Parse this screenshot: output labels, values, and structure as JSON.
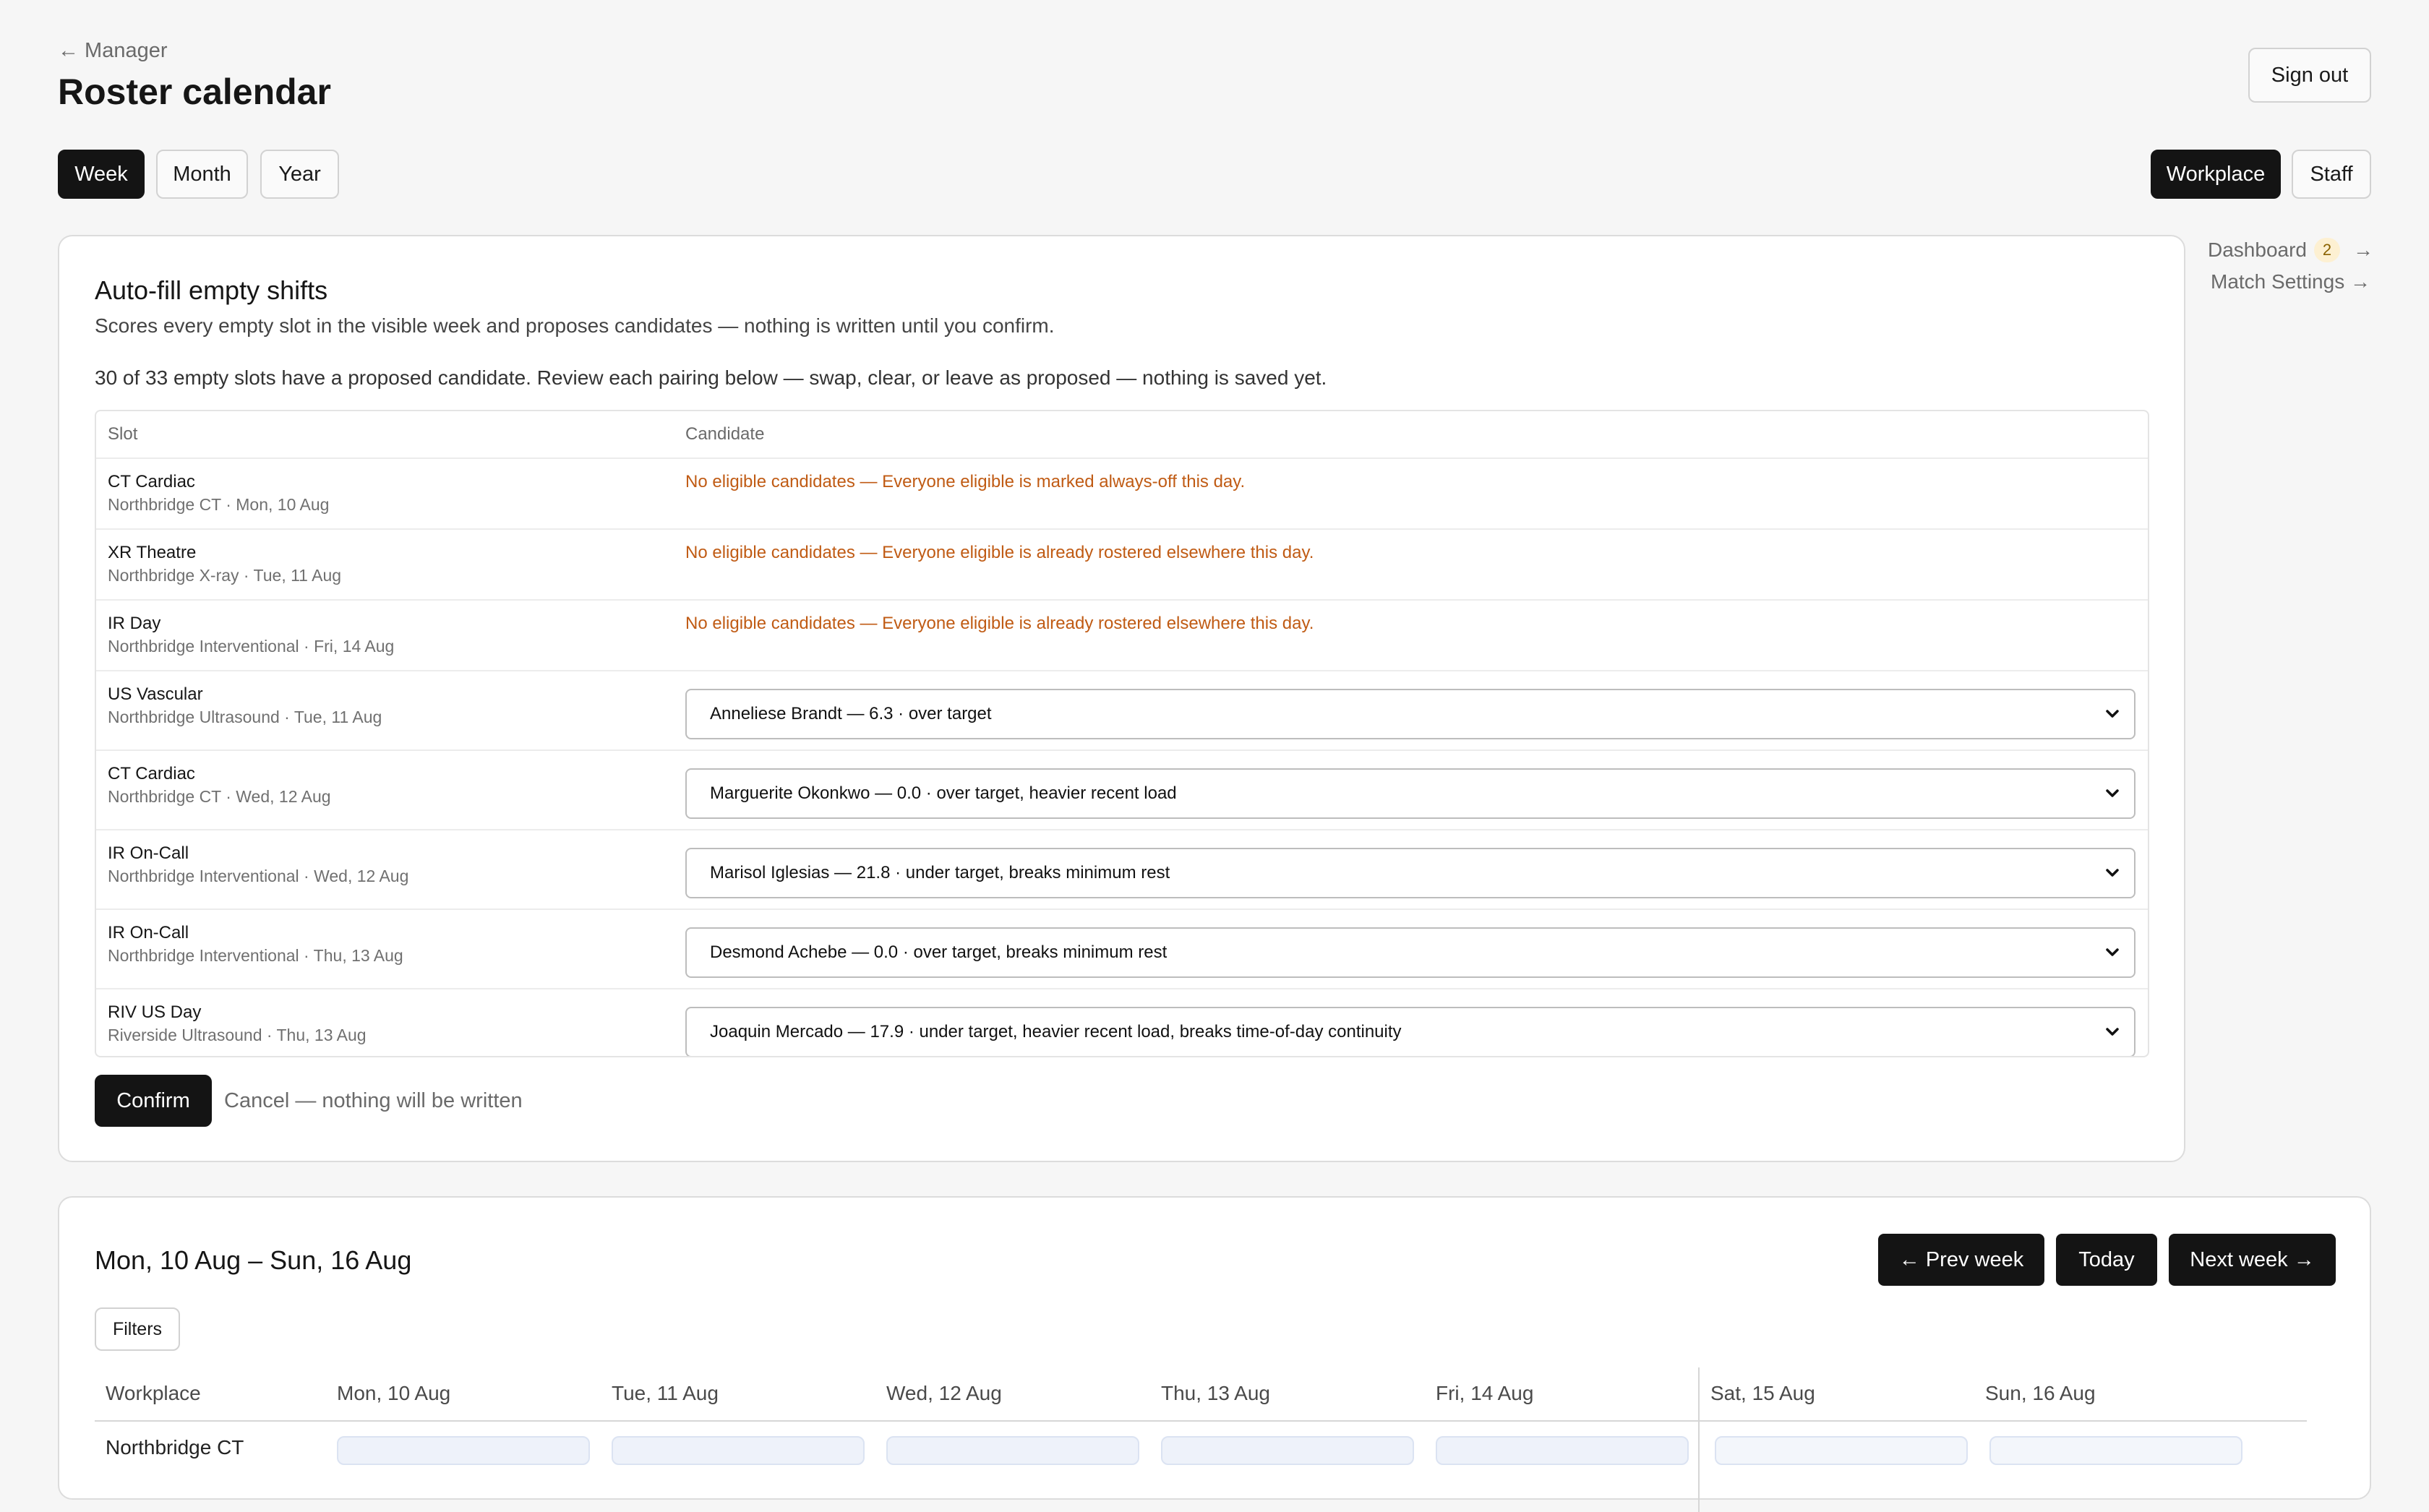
{
  "header": {
    "back_label": "← Manager",
    "title": "Roster calendar",
    "sign_out": "Sign out"
  },
  "view_tabs": [
    "Week",
    "Month",
    "Year"
  ],
  "active_view": "Week",
  "scope_tabs": [
    "Workplace",
    "Staff"
  ],
  "active_scope": "Workplace",
  "side_links": {
    "dashboard": "Dashboard",
    "dashboard_badge": "2",
    "dashboard_arrow": "→",
    "match_settings": "Match Settings →"
  },
  "autofill": {
    "title": "Auto-fill empty shifts",
    "description": "Scores every empty slot in the visible week and proposes candidates — nothing is written until you confirm.",
    "summary": "30 of 33 empty slots have a proposed candidate. Review each pairing below — swap, clear, or leave as proposed — nothing is saved yet.",
    "columns": {
      "slot": "Slot",
      "candidate": "Candidate"
    },
    "rows": [
      {
        "slot": "CT Cardiac",
        "location": "Northbridge CT · Mon, 10 Aug",
        "warning": "No eligible candidates — Everyone eligible is marked always-off this day."
      },
      {
        "slot": "XR Theatre",
        "location": "Northbridge X-ray · Tue, 11 Aug",
        "warning": "No eligible candidates — Everyone eligible is already rostered elsewhere this day."
      },
      {
        "slot": "IR Day",
        "location": "Northbridge Interventional · Fri, 14 Aug",
        "warning": "No eligible candidates — Everyone eligible is already rostered elsewhere this day."
      },
      {
        "slot": "US Vascular",
        "location": "Northbridge Ultrasound · Tue, 11 Aug",
        "candidate": "Anneliese Brandt — 6.3 · over target"
      },
      {
        "slot": "CT Cardiac",
        "location": "Northbridge CT · Wed, 12 Aug",
        "candidate": "Marguerite Okonkwo — 0.0 · over target, heavier recent load"
      },
      {
        "slot": "IR On-Call",
        "location": "Northbridge Interventional · Wed, 12 Aug",
        "candidate": "Marisol Iglesias — 21.8 · under target, breaks minimum rest"
      },
      {
        "slot": "IR On-Call",
        "location": "Northbridge Interventional · Thu, 13 Aug",
        "candidate": "Desmond Achebe — 0.0 · over target, breaks minimum rest"
      },
      {
        "slot": "RIV US Day",
        "location": "Riverside Ultrasound · Thu, 13 Aug",
        "candidate": "Joaquin Mercado — 17.9 · under target, heavier recent load, breaks time-of-day continuity"
      }
    ],
    "confirm": "Confirm",
    "cancel": "Cancel — nothing will be written"
  },
  "week": {
    "range": "Mon, 10 Aug – Sun, 16 Aug",
    "prev": "← Prev week",
    "today": "Today",
    "next": "Next week →",
    "filters": "Filters",
    "columns": [
      "Workplace",
      "Mon, 10 Aug",
      "Tue, 11 Aug",
      "Wed, 12 Aug",
      "Thu, 13 Aug",
      "Fri, 14 Aug",
      "Sat, 15 Aug",
      "Sun, 16 Aug"
    ],
    "first_row": "Northbridge CT"
  }
}
